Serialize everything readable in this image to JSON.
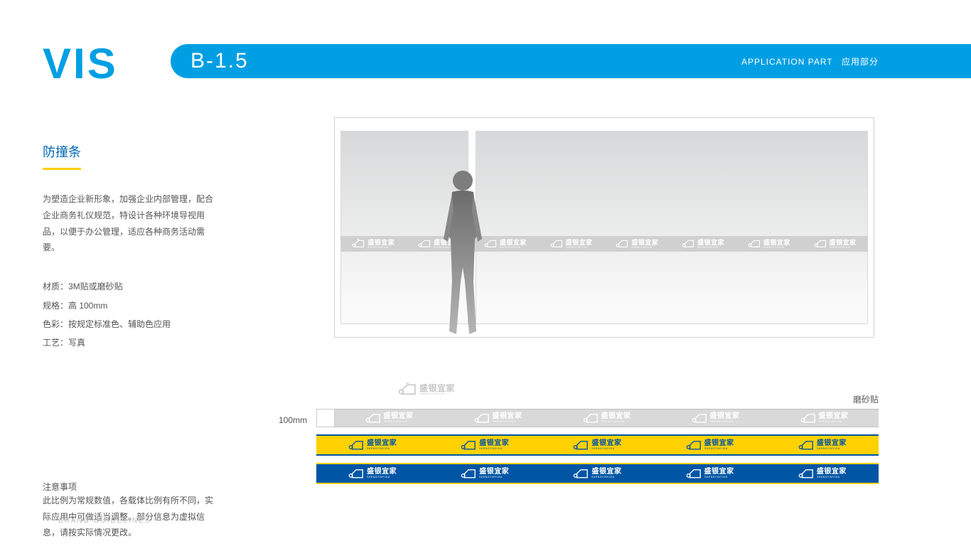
{
  "header": {
    "vis": "VIS",
    "section_code": "B-1.5",
    "app_part_en": "APPLICATION PART",
    "app_part_cn": "应用部分"
  },
  "left": {
    "title": "防撞条",
    "desc": "为塑造企业新形象，加强企业内部管理，配合企业商务礼仪规范，特设计各种环境导视用品，以便于办公管理，适应各种商务活动需要。",
    "spec_material": "材质：3M贴或磨砂贴",
    "spec_size": "规格：高 100mm",
    "spec_color": "色彩：按规定标准色、辅助色应用",
    "spec_process": "工艺：写真",
    "notes_h": "注意事项",
    "notes_body": "此比例为常规数值，各载体比例有所不同，实际应用中可做适当调整。部分信息为虚拟信息，请按实际情况更改。"
  },
  "labels": {
    "dim": "100mm",
    "frosted": "磨砂贴"
  },
  "logo": {
    "zh": "盛银宜家",
    "py": "SHENGYINYIJIA"
  },
  "footer": "BRAND GUIDELINES"
}
